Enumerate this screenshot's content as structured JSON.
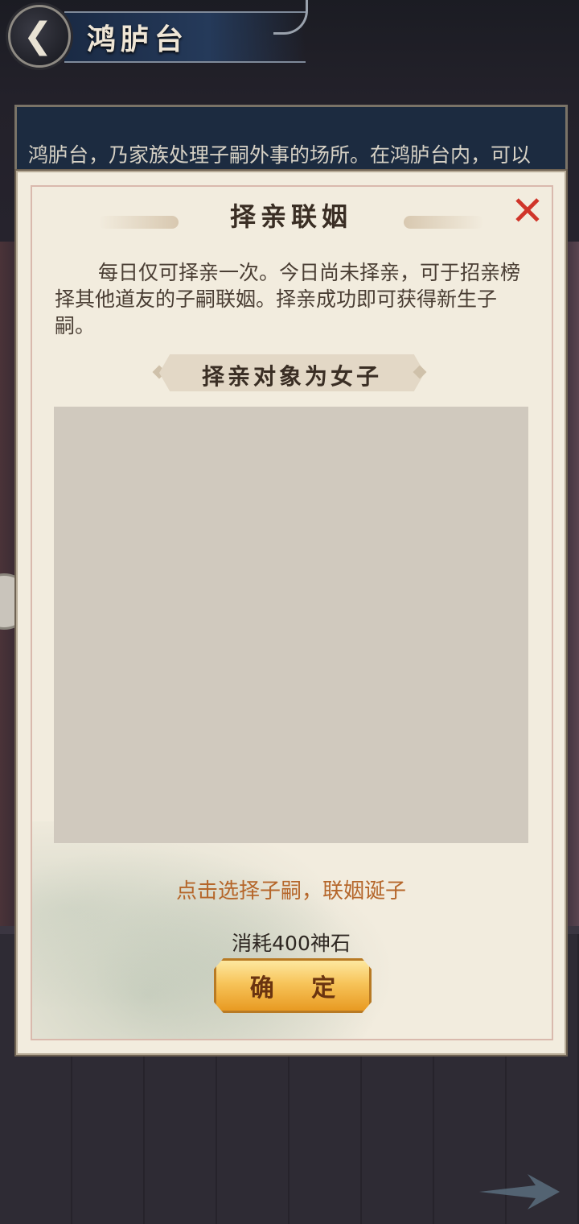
{
  "header": {
    "title": "鸿胪台",
    "back_icon": "chevron-left-icon"
  },
  "info": {
    "text": "鸿胪台，乃家族处理子嗣外事的场所。在鸿胪台内，可以"
  },
  "modal": {
    "title": "择亲联姻",
    "close_icon": "close-icon",
    "description": "每日仅可择亲一次。今日尚未择亲，可于招亲榜择其他道友的子嗣联姻。择亲成功即可获得新生子嗣。",
    "subtitle": "择亲对象为女子",
    "hint": "点击选择子嗣，联姻诞子",
    "cost": "消耗400神石",
    "confirm_label": "确 定"
  },
  "colors": {
    "close": "#d0352a",
    "hint": "#b5662a",
    "button_gold": "#f7c45a"
  }
}
